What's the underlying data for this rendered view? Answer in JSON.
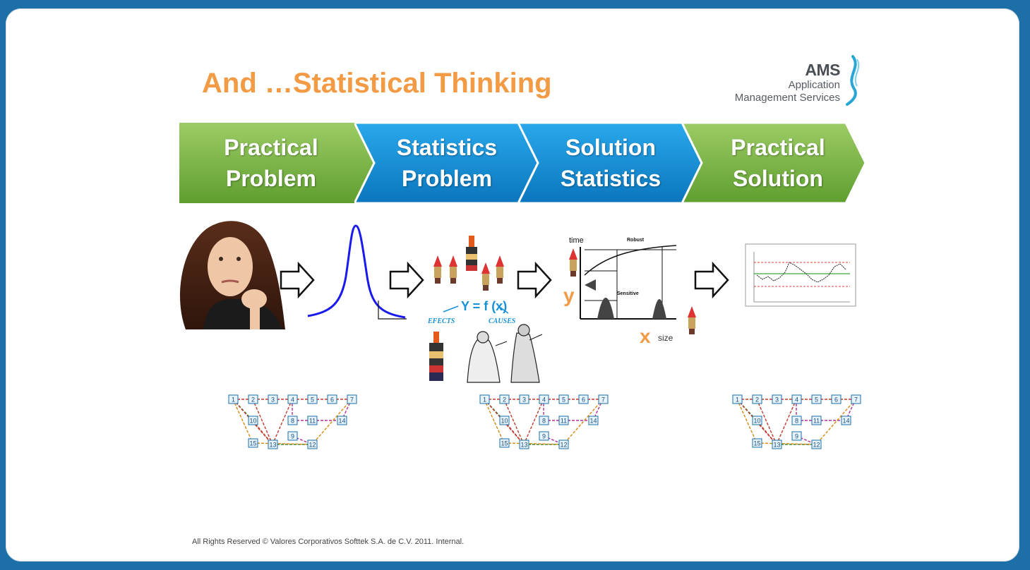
{
  "slide": {
    "title": "And …Statistical Thinking",
    "logo": {
      "name": "AMS",
      "line1": "Application",
      "line2": "Management Services"
    },
    "steps": [
      {
        "label": "Practical\nProblem",
        "color": "#7cb342"
      },
      {
        "label": "Statistics\nProblem",
        "color": "#1591d8"
      },
      {
        "label": "Solution\nStatistics",
        "color": "#1591d8"
      },
      {
        "label": "Practical\nSolution",
        "color": "#7cb342"
      }
    ],
    "equation": "Y = f (x)",
    "effects_label": "EFECTS",
    "causes_label": "CAUSES",
    "graph_labels": {
      "time": "time",
      "robust": "Robust",
      "sensitive": "Sensitive",
      "y": "y",
      "x": "x",
      "size": "size"
    },
    "network_nodes": [
      "1",
      "2",
      "3",
      "4",
      "5",
      "6",
      "7",
      "8",
      "9",
      "10",
      "11",
      "12",
      "13",
      "14",
      "15"
    ],
    "footer": "All Rights Reserved © Valores Corporativos Softtek S.A. de C.V. 2011. Internal.",
    "colors": {
      "orange": "#f39a45",
      "green": "#7cb342",
      "blue": "#1591d8",
      "curve": "#1a1aee"
    }
  }
}
